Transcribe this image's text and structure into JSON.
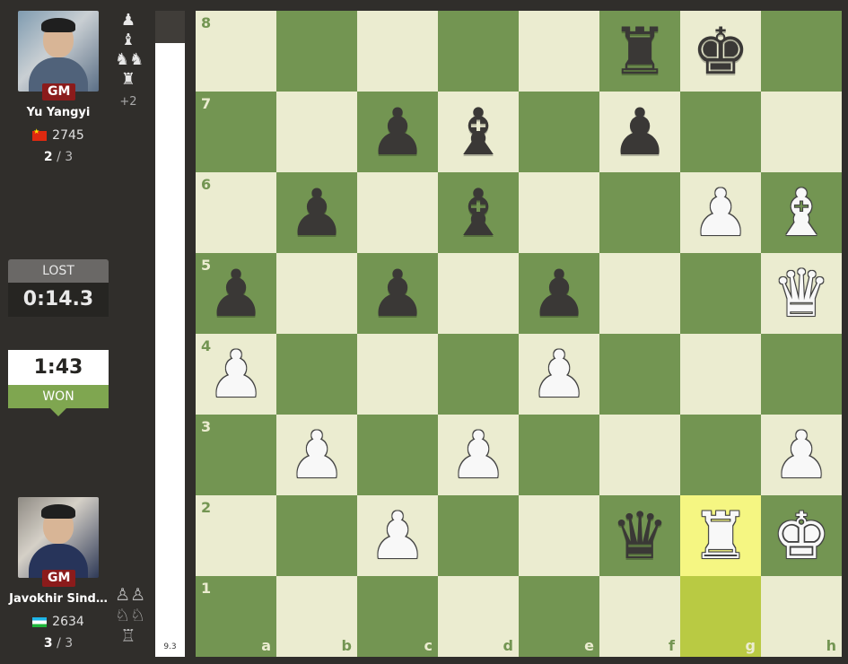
{
  "top_player": {
    "title": "GM",
    "name": "Yu Yangyi",
    "country": "cn",
    "rating": "2745",
    "score": "2",
    "score_total": "/ 3",
    "captured": [
      "♟",
      "♝",
      "♞♞",
      "♜"
    ],
    "material_advantage": "+2"
  },
  "bottom_player": {
    "title": "GM",
    "name": "Javokhir Sind…",
    "country": "uz",
    "rating": "2634",
    "score": "3",
    "score_total": "/ 3",
    "captured": [
      "♙♙",
      "♘♘",
      "♖"
    ]
  },
  "clocks": {
    "top": {
      "status": "LOST",
      "time": "0:14.3"
    },
    "bottom": {
      "time": "1:43",
      "status": "WON"
    }
  },
  "eval_bar": {
    "value": "9.3"
  },
  "board": {
    "files": [
      "a",
      "b",
      "c",
      "d",
      "e",
      "f",
      "g",
      "h"
    ],
    "ranks": [
      "8",
      "7",
      "6",
      "5",
      "4",
      "3",
      "2",
      "1"
    ],
    "highlighted": [
      "g2",
      "g1"
    ],
    "colors": {
      "light": "#ebecd0",
      "dark": "#739552",
      "highlight_light": "#f5f682",
      "highlight_dark": "#b9ca43"
    },
    "pieces": {
      "f8": "bR",
      "g8": "bK",
      "c7": "bP",
      "d7": "bB",
      "f7": "bP",
      "b6": "bP",
      "d6": "bB",
      "g6": "wP",
      "h6": "wB",
      "a5": "bP",
      "c5": "bP",
      "e5": "bP",
      "h5": "wQ",
      "a4": "wP",
      "e4": "wP",
      "b3": "wP",
      "d3": "wP",
      "h3": "wP",
      "c2": "wP",
      "f2": "bQ",
      "g2": "wR",
      "h2": "wK"
    }
  }
}
